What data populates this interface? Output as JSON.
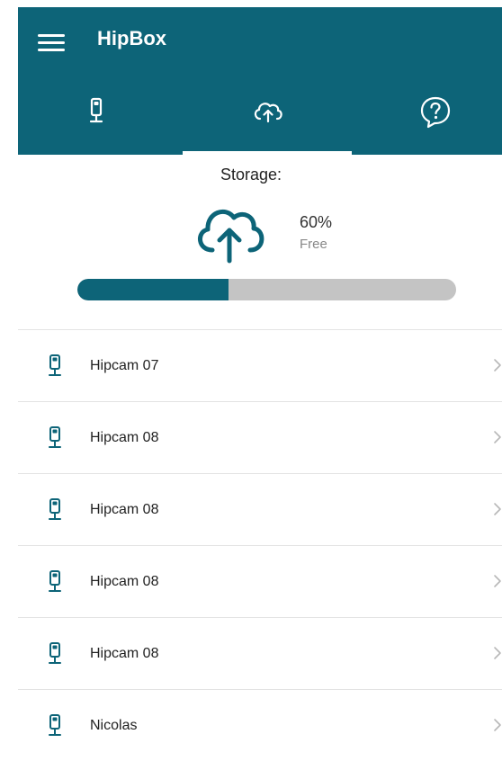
{
  "app": {
    "title": "HipBox"
  },
  "tabs": [
    {
      "name": "camera",
      "icon": "camera-icon",
      "active": false
    },
    {
      "name": "cloud",
      "icon": "cloud-upload-icon",
      "active": true
    },
    {
      "name": "help",
      "icon": "help-chat-icon",
      "active": false
    }
  ],
  "storage": {
    "label": "Storage:",
    "percent_label": "60%",
    "free_label": "Free",
    "used_fraction": 0.4
  },
  "cameras": [
    {
      "name": "Hipcam 07"
    },
    {
      "name": "Hipcam 08"
    },
    {
      "name": "Hipcam 08"
    },
    {
      "name": "Hipcam 08"
    },
    {
      "name": "Hipcam 08"
    },
    {
      "name": "Nicolas"
    }
  ],
  "colors": {
    "primary": "#0d6478",
    "track": "#c4c4c4"
  }
}
